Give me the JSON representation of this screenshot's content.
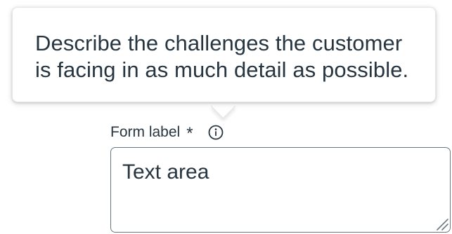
{
  "tooltip": {
    "line1": "Describe the challenges the customer",
    "line2": "is facing in as much detail as possible."
  },
  "field": {
    "label": "Form label",
    "required_mark": "*",
    "info_icon": "info-circle-icon",
    "value": "Text area",
    "resize_icon": "resize-handle-icon"
  },
  "colors": {
    "text": "#273540",
    "border": "#6b7780",
    "tooltip_border": "#e4e6e8",
    "background": "#ffffff"
  }
}
